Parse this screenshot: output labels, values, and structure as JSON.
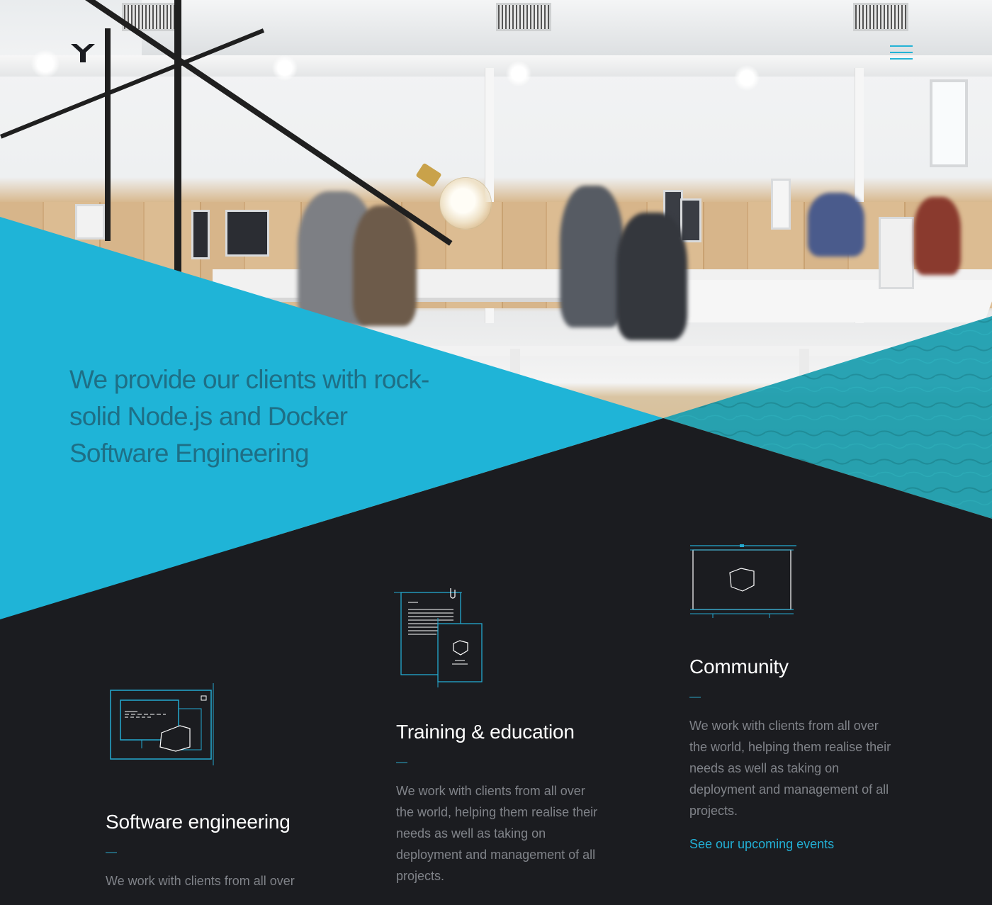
{
  "header": {
    "logo_icon": "y-logo-icon",
    "menu_icon": "hamburger-menu-icon"
  },
  "hero": {
    "title": "We provide our clients with rock-solid Node.js and Docker Software Engineering",
    "image": "office-photo"
  },
  "services": [
    {
      "icon": "code-window-icon",
      "title": "Software engineering",
      "dash": "—",
      "text": "We work with clients from all over"
    },
    {
      "icon": "document-book-icon",
      "title": "Training & education",
      "dash": "—",
      "text": "We work with clients from all over the world, helping them realise their needs as well as taking on deployment and management of all projects."
    },
    {
      "icon": "presentation-screen-icon",
      "title": "Community",
      "dash": "—",
      "text": "We work with clients from all over the world, helping them realise their needs as well as taking on deployment and management of all projects.",
      "link": "See our upcoming events"
    }
  ],
  "colors": {
    "accent": "#22b0d6",
    "triangle": "#1fb4d7",
    "dark_bg": "#1b1c20",
    "teal_overlay": "#1e9fb0"
  }
}
